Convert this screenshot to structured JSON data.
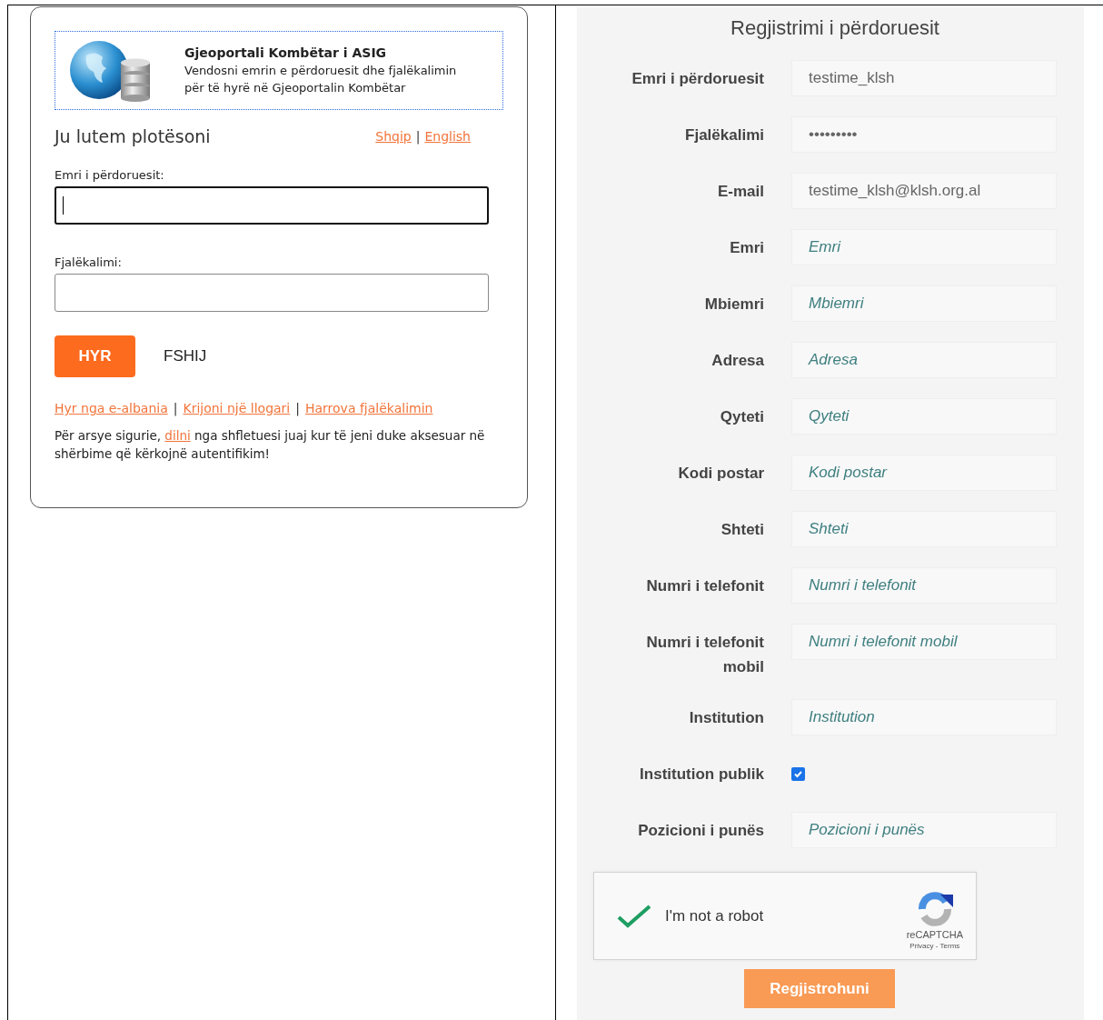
{
  "login": {
    "header": {
      "title": "Gjeoportali Kombëtar i ASIG",
      "description": "Vendosni emrin e përdoruesit dhe fjalëkalimin për të hyrë në Gjeoportalin Kombëtar"
    },
    "prompt": "Ju lutem plotësoni",
    "languages": [
      {
        "kind": "link",
        "label": "Shqip"
      },
      {
        "kind": "separator",
        "label": "|"
      },
      {
        "kind": "link",
        "label": "English"
      }
    ],
    "fields": [
      {
        "label": "Emri i përdoruesit:",
        "focused": true
      },
      {
        "label": "Fjalëkalimi:",
        "focused": false
      }
    ],
    "buttons": [
      {
        "label": "HYR",
        "kind": "primary"
      },
      {
        "label": "FSHIJ",
        "kind": "plain"
      }
    ],
    "links": [
      {
        "kind": "link",
        "label": "Hyr nga e-albania"
      },
      {
        "kind": "separator",
        "label": "|"
      },
      {
        "kind": "link",
        "label": "Krijoni një llogari"
      },
      {
        "kind": "separator",
        "label": "|"
      },
      {
        "kind": "link",
        "label": "Harrova fjalëkalimin"
      }
    ],
    "notice": {
      "before": "Për arsye sigurie,",
      "link": "dilni",
      "after": "nga shfletuesi juaj kur të jeni duke aksesuar në shërbime që kërkojnë autentifikim!"
    }
  },
  "registration": {
    "title": "Regjistrimi i përdoruesit",
    "fields": [
      {
        "kind": "text",
        "label": "Emri i përdoruesit",
        "value": "testime_klsh"
      },
      {
        "kind": "text",
        "label": "Fjalëkalimi",
        "value": "•••••••••"
      },
      {
        "kind": "text",
        "label": "E-mail",
        "value": "testime_klsh@klsh.org.al"
      },
      {
        "kind": "text",
        "label": "Emri",
        "placeholder": "Emri"
      },
      {
        "kind": "text",
        "label": "Mbiemri",
        "placeholder": "Mbiemri"
      },
      {
        "kind": "text",
        "label": "Adresa",
        "placeholder": "Adresa"
      },
      {
        "kind": "text",
        "label": "Qyteti",
        "placeholder": "Qyteti"
      },
      {
        "kind": "text",
        "label": "Kodi postar",
        "placeholder": "Kodi postar"
      },
      {
        "kind": "text",
        "label": "Shteti",
        "placeholder": "Shteti"
      },
      {
        "kind": "text",
        "label": "Numri i telefonit",
        "placeholder": "Numri i telefonit"
      },
      {
        "kind": "text",
        "label": "Numri i telefonit mobil",
        "placeholder": "Numri i telefonit mobil"
      },
      {
        "kind": "text",
        "label": "Institution",
        "placeholder": "Institution"
      },
      {
        "kind": "checkbox",
        "label": "Institution publik",
        "checked": true
      },
      {
        "kind": "text",
        "label": "Pozicioni i punës",
        "placeholder": "Pozicioni i punës"
      }
    ],
    "captcha": {
      "label": "I'm not a robot",
      "checked": true,
      "brand": "reCAPTCHA",
      "terms": "Privacy - Terms"
    },
    "submit": "Regjistrohuni"
  }
}
